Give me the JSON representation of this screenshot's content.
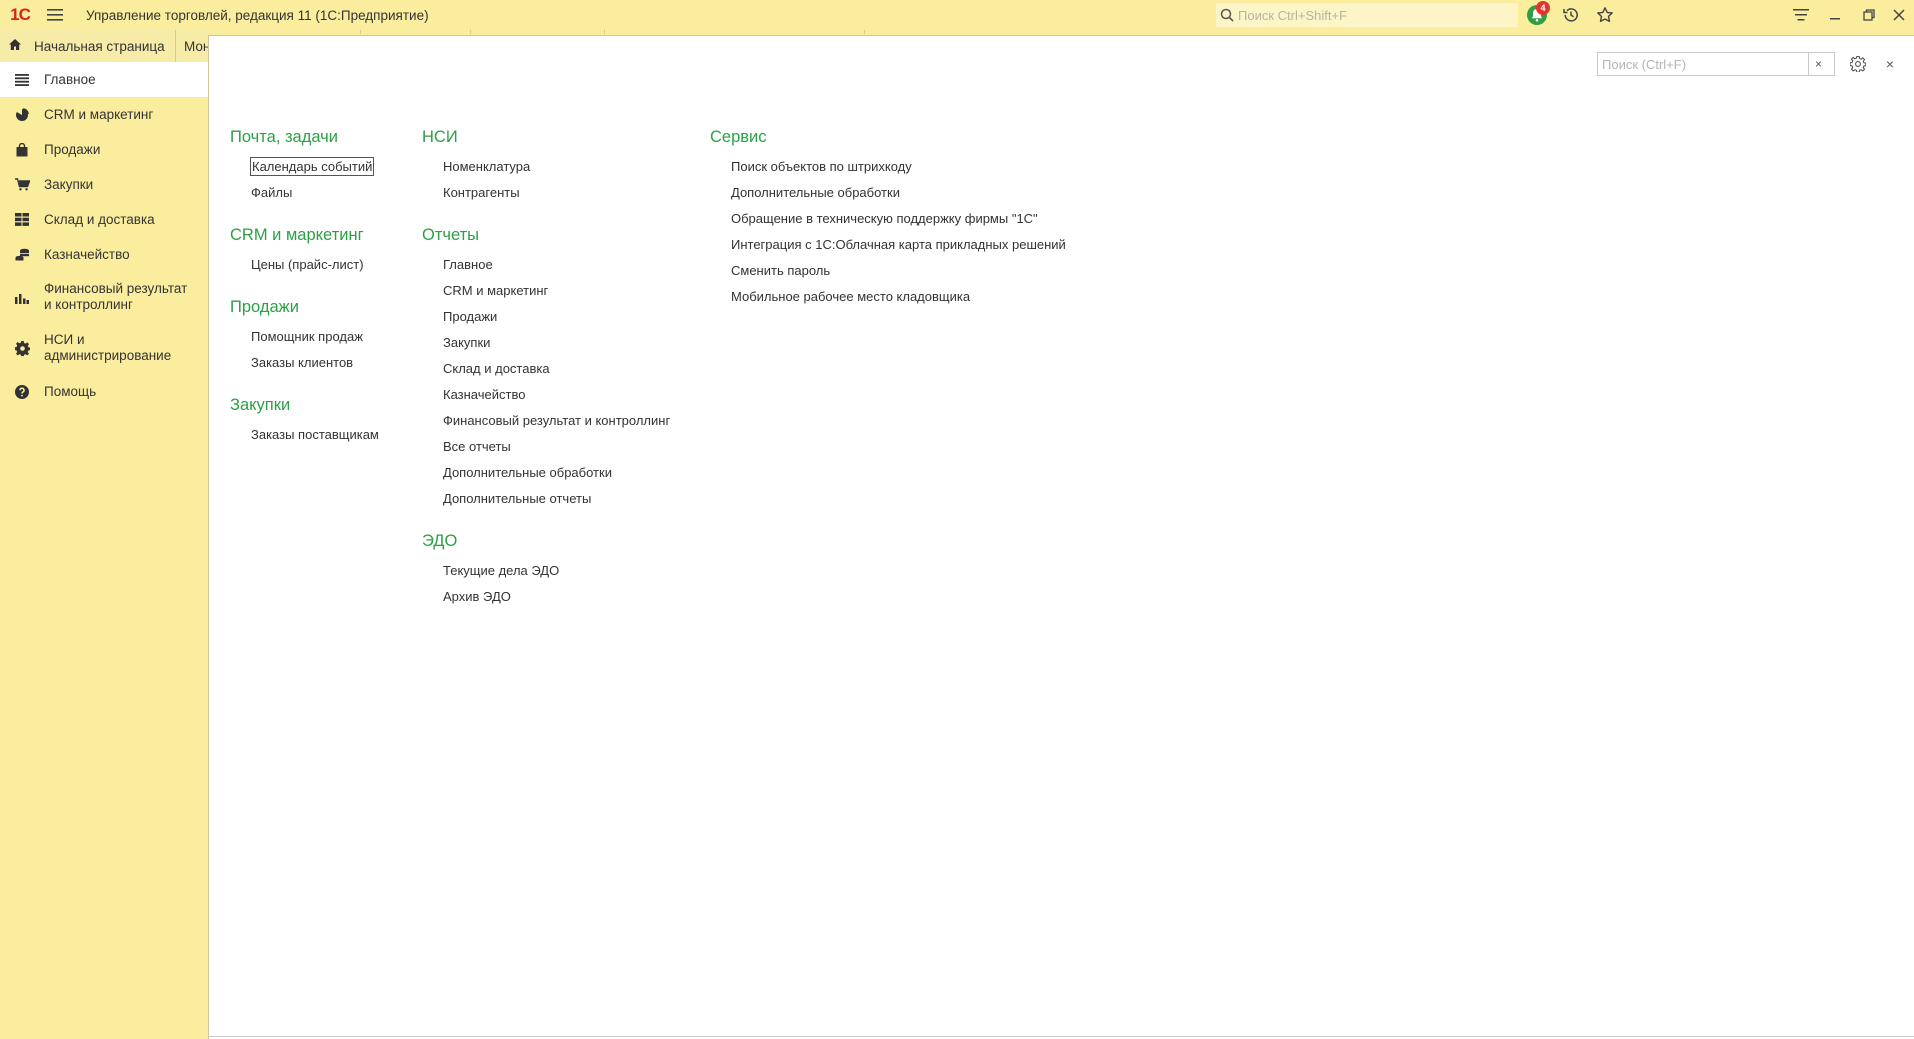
{
  "titlebar": {
    "logo": "1С",
    "app_title": "Управление торговлей, редакция 11  (1С:Предприятие)",
    "search_placeholder": "Поиск Ctrl+Shift+F",
    "notifications_count": "4"
  },
  "tabs": {
    "home_label": "Начальная страница",
    "second_label": "Мон"
  },
  "sidebar": {
    "items": [
      {
        "label": "Главное",
        "icon": "list-icon"
      },
      {
        "label": "CRM и маркетинг",
        "icon": "pie-chart-icon"
      },
      {
        "label": "Продажи",
        "icon": "shopping-bag-icon"
      },
      {
        "label": "Закупки",
        "icon": "cart-icon"
      },
      {
        "label": "Склад и доставка",
        "icon": "warehouse-icon"
      },
      {
        "label": "Казначейство",
        "icon": "coins-icon"
      },
      {
        "label": "Финансовый результат и контроллинг",
        "icon": "bar-chart-icon"
      },
      {
        "label": "НСИ и администрирование",
        "icon": "gear-icon"
      },
      {
        "label": "Помощь",
        "icon": "help-icon"
      }
    ]
  },
  "panel": {
    "search_placeholder": "Поиск (Ctrl+F)",
    "clear_label": "×",
    "close_label": "×"
  },
  "columns": [
    [
      {
        "title": "Почта, задачи",
        "links": [
          "Календарь событий",
          "Файлы"
        ]
      },
      {
        "title": "CRM и маркетинг",
        "links": [
          "Цены (прайс-лист)"
        ]
      },
      {
        "title": "Продажи",
        "links": [
          "Помощник продаж",
          "Заказы клиентов"
        ]
      },
      {
        "title": "Закупки",
        "links": [
          "Заказы поставщикам"
        ]
      }
    ],
    [
      {
        "title": "НСИ",
        "links": [
          "Номенклатура",
          "Контрагенты"
        ]
      },
      {
        "title": "Отчеты",
        "links": [
          "Главное",
          "CRM и маркетинг",
          "Продажи",
          "Закупки",
          "Склад и доставка",
          "Казначейство",
          "Финансовый результат и контроллинг",
          "Все отчеты",
          "Дополнительные обработки",
          "Дополнительные отчеты"
        ]
      },
      {
        "title": "ЭДО",
        "links": [
          "Текущие дела ЭДО",
          "Архив ЭДО"
        ]
      }
    ],
    [
      {
        "title": "Сервис",
        "links": [
          "Поиск объектов по штрихкоду",
          "Дополнительные обработки",
          "Обращение в техническую поддержку фирмы \"1С\"",
          "Интеграция с 1С:Облачная карта прикладных решений",
          "Сменить пароль",
          "Мобильное рабочее место кладовщика"
        ]
      }
    ]
  ],
  "colors": {
    "sidebar_bg": "#fbed9e",
    "section_heading": "#2aa145",
    "badge": "#e3342f"
  }
}
